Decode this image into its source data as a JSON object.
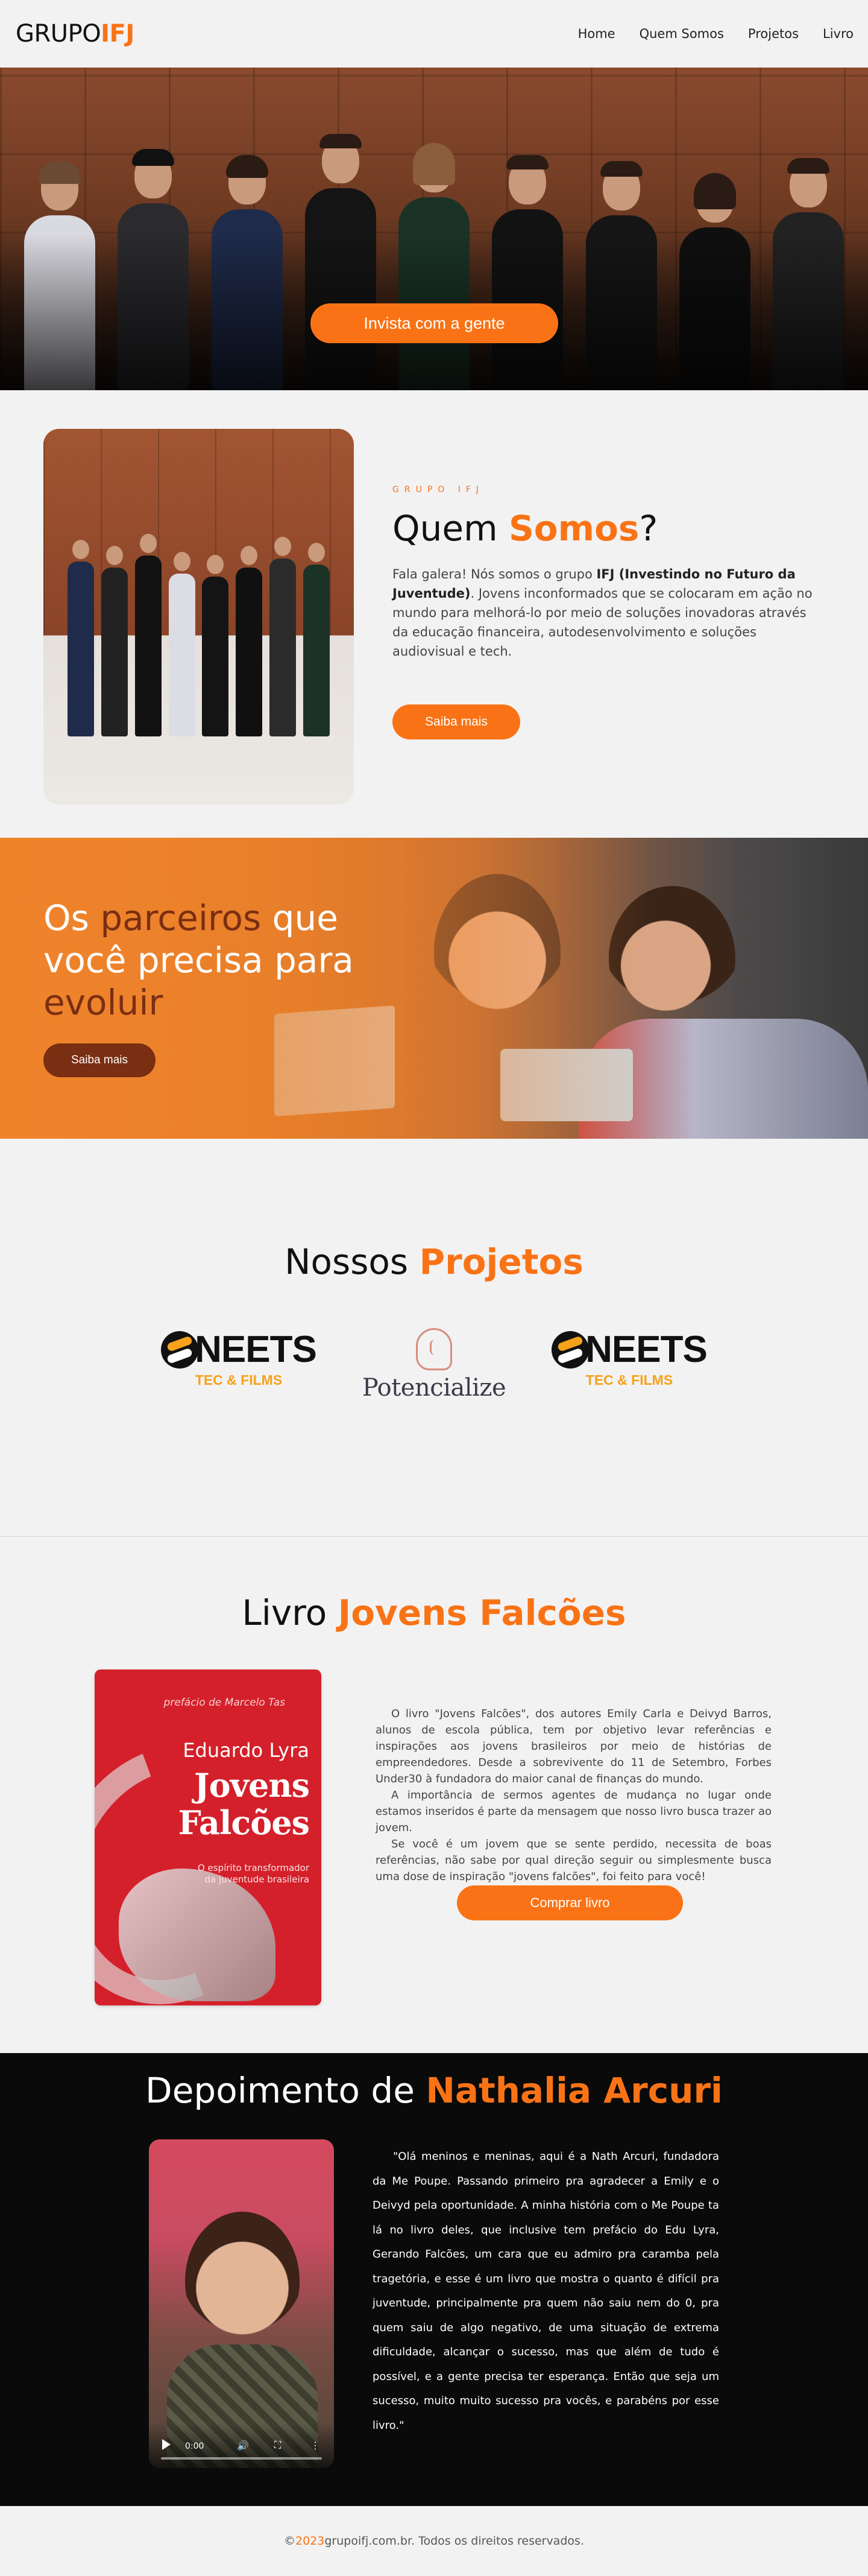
{
  "header": {
    "logo_main": "GRUPO",
    "logo_accent": "IFJ",
    "nav": [
      "Home",
      "Quem Somos",
      "Projetos",
      "Livro"
    ]
  },
  "hero": {
    "cta": "Invista com a gente"
  },
  "about": {
    "eyebrow": "GRUPO IFJ",
    "title_plain": "Quem ",
    "title_accent": "Somos",
    "title_end": "?",
    "desc_start": "Fala galera! Nós somos o grupo ",
    "desc_bold": "IFJ (Investindo no Futuro da Juventude)",
    "desc_end": ". Jovens inconformados que se colocaram em ação no mundo para melhorá-lo por meio de soluções inovadoras através da educação financeira, autodesenvolvimento e soluções audiovisual e tech.",
    "button": "Saiba mais"
  },
  "partners": {
    "w1": "Os ",
    "w2": "parceiros",
    "w3": " que você precisa para ",
    "w4": "evoluir",
    "button": "Saiba mais"
  },
  "projects": {
    "title_plain": "Nossos ",
    "title_accent": "Projetos",
    "logos": [
      {
        "word": "NEETS",
        "sub": "TEC & FILMS"
      },
      {
        "word": "Potencialize"
      },
      {
        "word": "NEETS",
        "sub": "TEC & FILMS"
      }
    ]
  },
  "book": {
    "title_plain": "Livro ",
    "title_accent": "Jovens Falcões",
    "cover": {
      "preface": "prefácio de Marcelo Tas",
      "author": "Eduardo Lyra",
      "title1": "Jovens",
      "title2": "Falcões",
      "subtitle": "O espírito transformador da juventude brasileira"
    },
    "p1": "O livro \"Jovens Falcões\", dos autores Emily Carla e Deivyd Barros, alunos de escola pública, tem por objetivo levar referências e inspirações aos jovens brasileiros por meio de histórias de empreendedores. Desde a sobrevivente do 11 de Setembro, Forbes Under30 à fundadora do maior canal de finanças do mundo.",
    "p2": "A importância de sermos agentes de mudança no lugar onde estamos inseridos é parte da mensagem que nosso livro busca trazer ao jovem.",
    "p3": "Se você é um jovem que se sente perdido, necessita de boas referências, não sabe por qual direção seguir ou simplesmente busca uma dose de inspiração \"jovens falcões\", foi feito para você!",
    "button": "Comprar livro"
  },
  "testimonial": {
    "title_plain": "Depoimento de ",
    "title_accent": "Nathalia Arcuri",
    "video_time": "0:00",
    "quote": "\"Olá meninos e meninas, aqui é a Nath Arcuri, fundadora da Me Poupe. Passando primeiro pra agradecer a Emily e o Deivyd pela oportunidade. A minha história com o Me Poupe ta lá no livro deles, que inclusive tem prefácio do Edu Lyra, Gerando Falcões, um cara que eu admiro pra caramba pela tragetória, e esse é um livro que mostra o quanto é difícil pra juventude, principalmente pra quem não saiu nem do 0, pra quem saiu de algo negativo, de uma situação de extrema dificuldade, alcançar o sucesso, mas que além de tudo é possível, e a gente precisa ter esperança. Então que seja um sucesso, muito muito sucesso pra vocês, e parabéns por esse livro.\""
  },
  "footer": {
    "symbol": "© ",
    "year": "2023",
    "text": " grupoifj.com.br. Todos os direitos reservados."
  },
  "colors": {
    "accent": "#f97316",
    "dark_accent": "#7a2e12",
    "background": "#f2f2f2",
    "dark_section": "#0a0a0a"
  }
}
